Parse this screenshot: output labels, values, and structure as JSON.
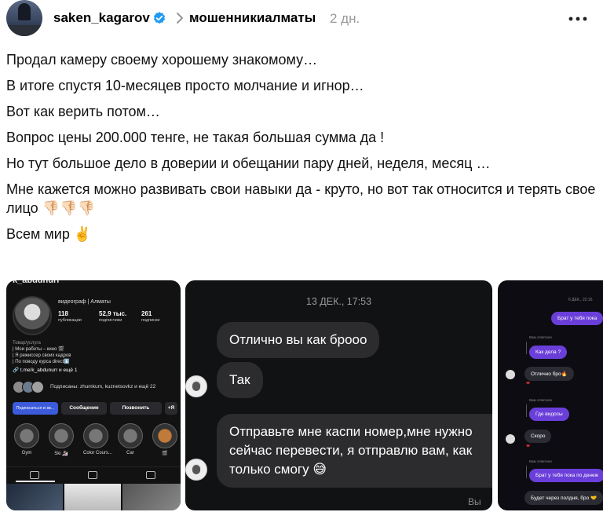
{
  "header": {
    "username": "saken_kagarov",
    "community": "мошенникиалматы",
    "time": "2 дн.",
    "colors": {
      "verified": "#1d9bf0",
      "time": "#9a9a9a"
    }
  },
  "post": {
    "lines": [
      "Продал камеру своему хорошему знакомому…",
      "В итоге спустя 10-месяцев просто молчание и игнор…",
      "Вот как верить потом…",
      "Вопрос цены 200.000 тенге, не такая большая сумма да !",
      "Но тут большое дело в доверии и обещании пару дней, неделя, месяц …",
      "Мне кажется можно развивать свои навыки да - круто, но вот так относится и терять свое лицо 👎🏻👎🏻👎🏻",
      "Всем мир ✌️"
    ]
  },
  "image1": {
    "handle": "k_abdunurr",
    "role": "видеограф | Алматы",
    "stats": [
      {
        "value": "118",
        "label": "публикации"
      },
      {
        "value": "52,9 тыс.",
        "label": "подписчики"
      },
      {
        "value": "261",
        "label": "подписки"
      }
    ],
    "bio": [
      "Товар/услуга",
      "| Мои работы – кино 🎬",
      "| Я режиссер своих кадров",
      "| По поводу курса direct⬇️"
    ],
    "link": "🔗 t.me/k_abdunurr и ещё 1",
    "subscribers_text": "Подписаны: zhumkum, kuznetsovkz и ещё 22",
    "buttons": {
      "subscribed": "Подписаться в кв...",
      "message": "Сообщение",
      "call": "Позвонить",
      "add": "+Я"
    },
    "highlights": [
      "Gym",
      "Ski 🏂",
      "Color Cours...",
      "Car",
      "🎬"
    ]
  },
  "image2": {
    "date": "13 ДЕК., 17:53",
    "messages": [
      "Отлично вы как броoo",
      "Так",
      "Отправьте мне каспи номер,мне нужно сейчас перевести, я отправлю вам, как только смогу 😅"
    ],
    "partial": "Вы от"
  },
  "image3": {
    "date": "6 ДЕК., 22:16",
    "messages": [
      {
        "text": "Брат у тебя пока",
        "kind": "purple"
      },
      {
        "text": "Вам ответили",
        "kind": "reply"
      },
      {
        "text": "Как дела ?",
        "kind": "purple"
      },
      {
        "text": "Отлично бро🔥",
        "kind": "dark"
      },
      {
        "text": "Вам ответили",
        "kind": "reply"
      },
      {
        "text": "Где видосы",
        "kind": "purple"
      },
      {
        "text": "Скоро",
        "kind": "dark"
      },
      {
        "text": "Вам ответили",
        "kind": "reply"
      },
      {
        "text": "Брат у тебя пока по денеж",
        "kind": "purple"
      },
      {
        "text": "Будет через полдня, бро 🤝",
        "kind": "dark"
      }
    ]
  }
}
